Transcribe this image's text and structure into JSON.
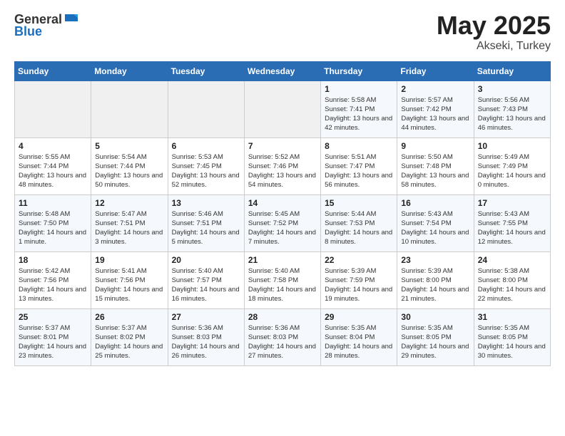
{
  "header": {
    "logo_general": "General",
    "logo_blue": "Blue",
    "month": "May 2025",
    "location": "Akseki, Turkey"
  },
  "days_of_week": [
    "Sunday",
    "Monday",
    "Tuesday",
    "Wednesday",
    "Thursday",
    "Friday",
    "Saturday"
  ],
  "weeks": [
    [
      {
        "day": "",
        "sunrise": "",
        "sunset": "",
        "daylight": ""
      },
      {
        "day": "",
        "sunrise": "",
        "sunset": "",
        "daylight": ""
      },
      {
        "day": "",
        "sunrise": "",
        "sunset": "",
        "daylight": ""
      },
      {
        "day": "",
        "sunrise": "",
        "sunset": "",
        "daylight": ""
      },
      {
        "day": "1",
        "sunrise": "Sunrise: 5:58 AM",
        "sunset": "Sunset: 7:41 PM",
        "daylight": "Daylight: 13 hours and 42 minutes."
      },
      {
        "day": "2",
        "sunrise": "Sunrise: 5:57 AM",
        "sunset": "Sunset: 7:42 PM",
        "daylight": "Daylight: 13 hours and 44 minutes."
      },
      {
        "day": "3",
        "sunrise": "Sunrise: 5:56 AM",
        "sunset": "Sunset: 7:43 PM",
        "daylight": "Daylight: 13 hours and 46 minutes."
      }
    ],
    [
      {
        "day": "4",
        "sunrise": "Sunrise: 5:55 AM",
        "sunset": "Sunset: 7:44 PM",
        "daylight": "Daylight: 13 hours and 48 minutes."
      },
      {
        "day": "5",
        "sunrise": "Sunrise: 5:54 AM",
        "sunset": "Sunset: 7:44 PM",
        "daylight": "Daylight: 13 hours and 50 minutes."
      },
      {
        "day": "6",
        "sunrise": "Sunrise: 5:53 AM",
        "sunset": "Sunset: 7:45 PM",
        "daylight": "Daylight: 13 hours and 52 minutes."
      },
      {
        "day": "7",
        "sunrise": "Sunrise: 5:52 AM",
        "sunset": "Sunset: 7:46 PM",
        "daylight": "Daylight: 13 hours and 54 minutes."
      },
      {
        "day": "8",
        "sunrise": "Sunrise: 5:51 AM",
        "sunset": "Sunset: 7:47 PM",
        "daylight": "Daylight: 13 hours and 56 minutes."
      },
      {
        "day": "9",
        "sunrise": "Sunrise: 5:50 AM",
        "sunset": "Sunset: 7:48 PM",
        "daylight": "Daylight: 13 hours and 58 minutes."
      },
      {
        "day": "10",
        "sunrise": "Sunrise: 5:49 AM",
        "sunset": "Sunset: 7:49 PM",
        "daylight": "Daylight: 14 hours and 0 minutes."
      }
    ],
    [
      {
        "day": "11",
        "sunrise": "Sunrise: 5:48 AM",
        "sunset": "Sunset: 7:50 PM",
        "daylight": "Daylight: 14 hours and 1 minute."
      },
      {
        "day": "12",
        "sunrise": "Sunrise: 5:47 AM",
        "sunset": "Sunset: 7:51 PM",
        "daylight": "Daylight: 14 hours and 3 minutes."
      },
      {
        "day": "13",
        "sunrise": "Sunrise: 5:46 AM",
        "sunset": "Sunset: 7:51 PM",
        "daylight": "Daylight: 14 hours and 5 minutes."
      },
      {
        "day": "14",
        "sunrise": "Sunrise: 5:45 AM",
        "sunset": "Sunset: 7:52 PM",
        "daylight": "Daylight: 14 hours and 7 minutes."
      },
      {
        "day": "15",
        "sunrise": "Sunrise: 5:44 AM",
        "sunset": "Sunset: 7:53 PM",
        "daylight": "Daylight: 14 hours and 8 minutes."
      },
      {
        "day": "16",
        "sunrise": "Sunrise: 5:43 AM",
        "sunset": "Sunset: 7:54 PM",
        "daylight": "Daylight: 14 hours and 10 minutes."
      },
      {
        "day": "17",
        "sunrise": "Sunrise: 5:43 AM",
        "sunset": "Sunset: 7:55 PM",
        "daylight": "Daylight: 14 hours and 12 minutes."
      }
    ],
    [
      {
        "day": "18",
        "sunrise": "Sunrise: 5:42 AM",
        "sunset": "Sunset: 7:56 PM",
        "daylight": "Daylight: 14 hours and 13 minutes."
      },
      {
        "day": "19",
        "sunrise": "Sunrise: 5:41 AM",
        "sunset": "Sunset: 7:56 PM",
        "daylight": "Daylight: 14 hours and 15 minutes."
      },
      {
        "day": "20",
        "sunrise": "Sunrise: 5:40 AM",
        "sunset": "Sunset: 7:57 PM",
        "daylight": "Daylight: 14 hours and 16 minutes."
      },
      {
        "day": "21",
        "sunrise": "Sunrise: 5:40 AM",
        "sunset": "Sunset: 7:58 PM",
        "daylight": "Daylight: 14 hours and 18 minutes."
      },
      {
        "day": "22",
        "sunrise": "Sunrise: 5:39 AM",
        "sunset": "Sunset: 7:59 PM",
        "daylight": "Daylight: 14 hours and 19 minutes."
      },
      {
        "day": "23",
        "sunrise": "Sunrise: 5:39 AM",
        "sunset": "Sunset: 8:00 PM",
        "daylight": "Daylight: 14 hours and 21 minutes."
      },
      {
        "day": "24",
        "sunrise": "Sunrise: 5:38 AM",
        "sunset": "Sunset: 8:00 PM",
        "daylight": "Daylight: 14 hours and 22 minutes."
      }
    ],
    [
      {
        "day": "25",
        "sunrise": "Sunrise: 5:37 AM",
        "sunset": "Sunset: 8:01 PM",
        "daylight": "Daylight: 14 hours and 23 minutes."
      },
      {
        "day": "26",
        "sunrise": "Sunrise: 5:37 AM",
        "sunset": "Sunset: 8:02 PM",
        "daylight": "Daylight: 14 hours and 25 minutes."
      },
      {
        "day": "27",
        "sunrise": "Sunrise: 5:36 AM",
        "sunset": "Sunset: 8:03 PM",
        "daylight": "Daylight: 14 hours and 26 minutes."
      },
      {
        "day": "28",
        "sunrise": "Sunrise: 5:36 AM",
        "sunset": "Sunset: 8:03 PM",
        "daylight": "Daylight: 14 hours and 27 minutes."
      },
      {
        "day": "29",
        "sunrise": "Sunrise: 5:35 AM",
        "sunset": "Sunset: 8:04 PM",
        "daylight": "Daylight: 14 hours and 28 minutes."
      },
      {
        "day": "30",
        "sunrise": "Sunrise: 5:35 AM",
        "sunset": "Sunset: 8:05 PM",
        "daylight": "Daylight: 14 hours and 29 minutes."
      },
      {
        "day": "31",
        "sunrise": "Sunrise: 5:35 AM",
        "sunset": "Sunset: 8:05 PM",
        "daylight": "Daylight: 14 hours and 30 minutes."
      }
    ]
  ]
}
